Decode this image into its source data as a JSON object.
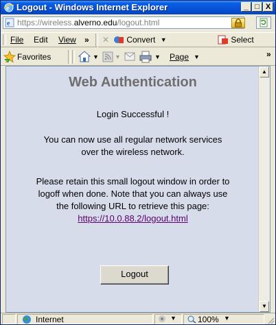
{
  "window": {
    "title": "Logout - Windows Internet Explorer",
    "buttons": {
      "minimize": "_",
      "maximize": "□",
      "close": "X"
    }
  },
  "address": {
    "prefix": "https://",
    "subdomain": "wireless.",
    "domain": "alverno.edu",
    "path": "/logout.html"
  },
  "menu": {
    "file": "File",
    "edit": "Edit",
    "view": "View",
    "more": "»",
    "convert": "Convert",
    "select": "Select"
  },
  "favorites": {
    "label": "Favorites",
    "page": "Page",
    "more": "»"
  },
  "content": {
    "heading": "Web Authentication",
    "success": "Login Successful !",
    "line1": "You can now use all regular network services",
    "line2": "over the wireless network.",
    "line3": "Please retain this small logout window in order to",
    "line4": "logoff when done. Note that you can always use",
    "line5": "the following URL to retrieve this page:",
    "link": "https://10.0.88.2/logout.html",
    "button": "Logout"
  },
  "status": {
    "zone": "Internet",
    "zoom": "100%"
  },
  "colors": {
    "title_bar": "#0752d6",
    "page_bg": "#d7dcea",
    "link": "#5a006e",
    "heading": "#6e6e6e"
  }
}
